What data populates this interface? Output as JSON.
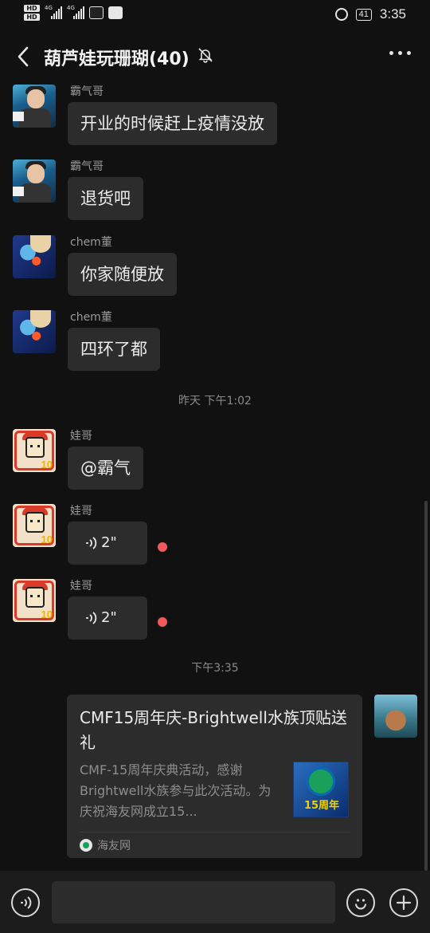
{
  "status_bar": {
    "hd_labels": [
      "HD",
      "HD"
    ],
    "network_labels": [
      "4G",
      "4G"
    ],
    "battery": "41",
    "time": "3:35",
    "icons": [
      "alarm-icon",
      "battery-icon",
      "charging-icon",
      "tiktok-icon",
      "app-icon"
    ]
  },
  "header": {
    "title": "葫芦娃玩珊瑚(40)",
    "icons": [
      "back-icon",
      "mute-icon",
      "more-icon"
    ]
  },
  "messages": [
    {
      "sender": "霸气哥",
      "text": "开业的时候赶上疫情没放",
      "type": "text"
    },
    {
      "sender": "霸气哥",
      "text": "退货吧",
      "type": "text"
    },
    {
      "sender": "chem董",
      "text": "你家随便放",
      "type": "text"
    },
    {
      "sender": "chem董",
      "text": "四环了都",
      "type": "text"
    },
    {
      "sender": "娃哥",
      "text": "@霸气",
      "type": "text"
    },
    {
      "sender": "娃哥",
      "text": "2\"",
      "type": "voice",
      "unread": true
    },
    {
      "sender": "娃哥",
      "text": "2\"",
      "type": "voice",
      "unread": true
    }
  ],
  "timestamps": [
    "昨天 下午1:02",
    "下午3:35"
  ],
  "link_card": {
    "title": "CMF15周年庆-Brightwell水族顶贴送礼",
    "description": "CMF-15周年庆典活动，感谢Brightwell水族参与此次活动。为庆祝海友网成立15...",
    "thumb_text": "15周年",
    "source": "海友网"
  },
  "input_bar": {
    "placeholder": "",
    "icons": [
      "voice-input-icon",
      "emoji-icon",
      "plus-icon"
    ]
  },
  "colors": {
    "background": "#111111",
    "bubble": "#2c2c2c",
    "unread_dot": "#f05a5a",
    "text": "#ececec",
    "muted": "#8d8d8d"
  }
}
